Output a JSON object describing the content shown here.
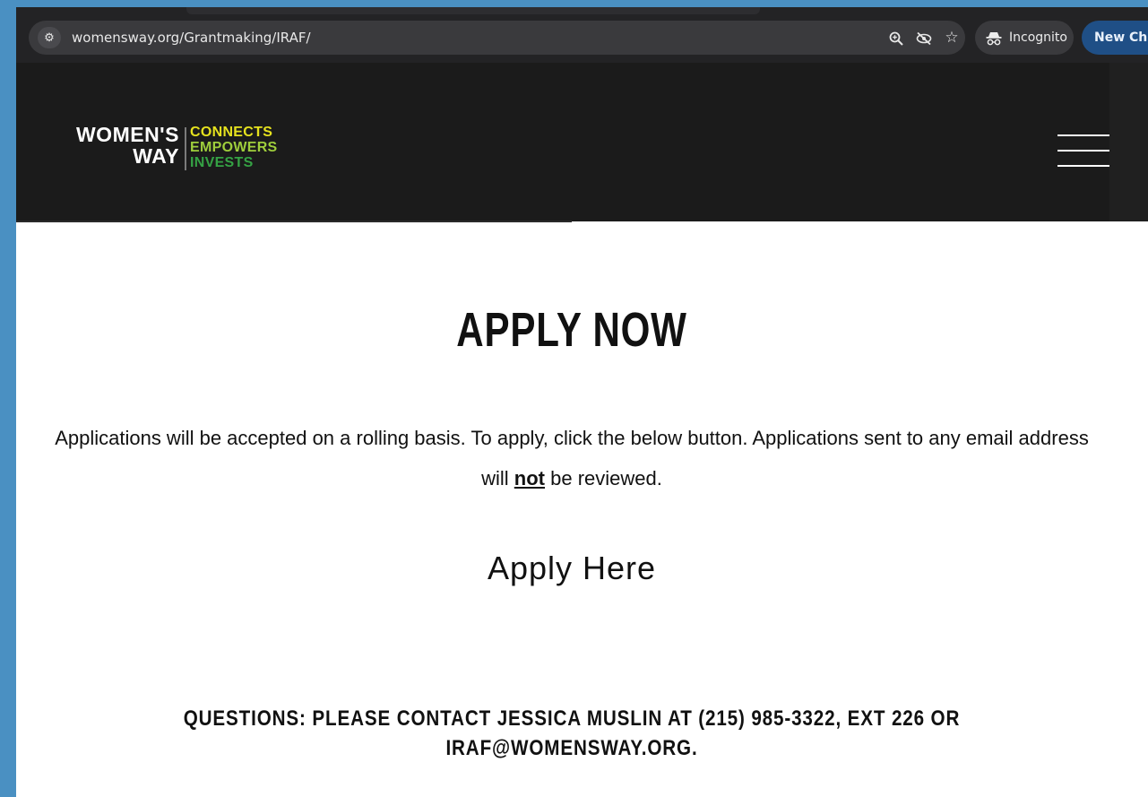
{
  "browser": {
    "url": "womensway.org/Grantmaking/IRAF/",
    "site_info_icon": "tune-icon",
    "zoom_icon": "zoom-icon",
    "tracking_icon": "eye-off-icon",
    "bookmark_icon": "star-icon",
    "incognito_label": "Incognito",
    "new_chrome_label": "New Chr"
  },
  "header": {
    "logo_line1": "WOMEN'S",
    "logo_line2": "WAY",
    "tag_connects": "CONNECTS",
    "tag_empowers": "EMPOWERS",
    "tag_invests": "INVESTS",
    "menu_icon": "hamburger-menu-icon"
  },
  "main": {
    "heading": "APPLY NOW",
    "para_before": "Applications will be accepted on a rolling basis. To apply, click the below button. Applications sent to any email address will ",
    "para_emph": "not",
    "para_after": " be reviewed.",
    "apply_link": "Apply Here",
    "contact_line1": "QUESTIONS: PLEASE CONTACT JESSICA MUSLIN AT (215) 985-3322, EXT 226 OR",
    "contact_line2": "IRAF@WOMENSWAY.ORG."
  },
  "colors": {
    "header_bg": "#1b1b1b",
    "tag_yellow": "#e6e21e",
    "tag_lime": "#9fce3c",
    "tag_green": "#35a244",
    "frame_blue": "#4a90c2"
  }
}
